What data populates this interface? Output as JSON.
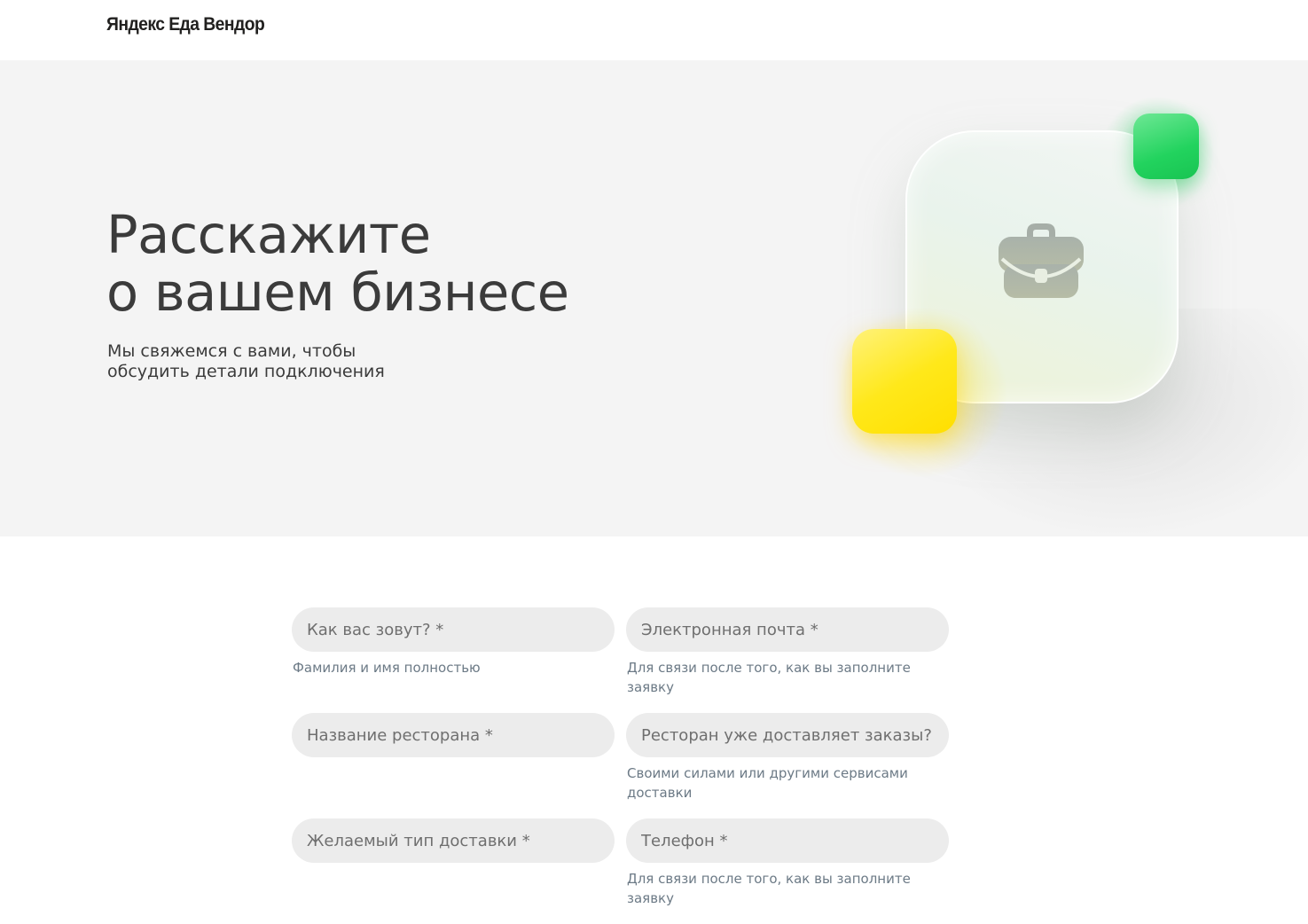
{
  "header": {
    "logo_text": "Яндекс Еда Вендор"
  },
  "hero": {
    "title": "Расскажите\nо вашем бизнесе",
    "subtitle": "Мы свяжемся с вами, чтобы\nобсудить детали подключения",
    "illustration": {
      "icon": "briefcase-icon",
      "colors": {
        "green_tile": "#22d35e",
        "yellow_tile": "#ffe81a"
      }
    }
  },
  "form": {
    "name": {
      "placeholder": "Как вас зовут? *",
      "value": "",
      "hint": "Фамилия и имя полностью"
    },
    "email": {
      "placeholder": "Электронная почта *",
      "value": "",
      "hint": "Для связи после того, как вы заполните заявку"
    },
    "restaurant": {
      "placeholder": "Название ресторана *",
      "value": "",
      "hint": ""
    },
    "delivers": {
      "placeholder": "Ресторан уже доставляет заказы? *",
      "value": "",
      "hint": "Своими силами или другими сервисами доставки"
    },
    "delivery_type": {
      "placeholder": "Желаемый тип доставки *",
      "value": "",
      "hint": ""
    },
    "phone": {
      "placeholder": "Телефон *",
      "value": "",
      "hint": "Для связи после того, как вы заполните заявку"
    }
  },
  "colors": {
    "hero_bg": "#f4f4f4",
    "input_bg": "#ececec",
    "hint_text": "#6c7a86"
  }
}
